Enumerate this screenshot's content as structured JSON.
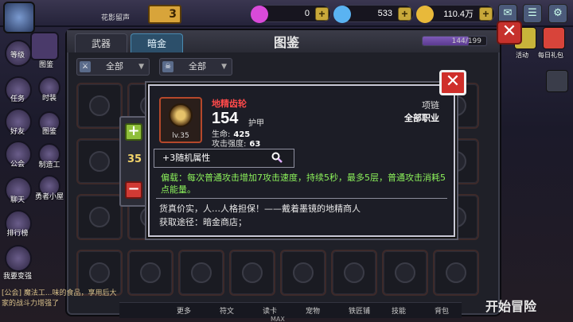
{
  "topbar": {
    "player_tag": "花影留声",
    "vip_label": "3",
    "resources": [
      {
        "name": "gem",
        "value": "0",
        "color": "#d94ad9"
      },
      {
        "name": "diamond",
        "value": "533",
        "color": "#5ab3f2"
      },
      {
        "name": "coin",
        "value": "110.4万",
        "color": "#e8b93a"
      }
    ],
    "icons": [
      "mail-icon",
      "settings-icon",
      "gear-icon"
    ]
  },
  "leftmenu": [
    {
      "label": "等级"
    },
    {
      "label": "图鉴"
    },
    {
      "label": "任务"
    },
    {
      "label": "时装"
    },
    {
      "label": "好友"
    },
    {
      "label": "图鉴"
    },
    {
      "label": "公会"
    },
    {
      "label": "制造工"
    },
    {
      "label": "聊天"
    },
    {
      "label": "勇者小屋"
    },
    {
      "label": "排行榜"
    },
    {
      "label": "我要变强"
    }
  ],
  "rightside": {
    "labels": [
      "活动",
      "每日礼包"
    ]
  },
  "book": {
    "tabs": [
      {
        "label": "武器",
        "active": false
      },
      {
        "label": "暗金",
        "active": true
      }
    ],
    "title": "图鉴",
    "progress_text": "144/199",
    "progress": 0.7236,
    "filters": [
      {
        "label": "全部"
      },
      {
        "label": "全部"
      }
    ]
  },
  "stepper": {
    "quantity": "35",
    "plus": "+",
    "minus": "−"
  },
  "popup": {
    "item_name": "地精齿轮",
    "level": "lv.35",
    "power": "154",
    "power_unit": "护甲",
    "stats": [
      {
        "label": "生命:",
        "value": "425"
      },
      {
        "label": "攻击强度:",
        "value": "63"
      }
    ],
    "slot": "项链",
    "job": "全部职业",
    "random_attr": "+3随机属性",
    "desc": "偏载：每次普通攻击增加7攻击速度，持续5秒，最多5层，普通攻击消耗5点能量。",
    "flavor": "货真价实，人…人格担保！——戴着墨镜的地精商人",
    "source": "获取途径：暗金商店；",
    "close": "✕"
  },
  "bottombar": {
    "items": [
      "更多",
      "符文",
      "读卡",
      "宠物",
      "铁匠铺",
      "技能",
      "背包"
    ]
  },
  "start_button": "开始冒险",
  "notice": "[公会] 魔法工...味的食品，享用后大家的战斗力增强了",
  "max_label": "MAX"
}
